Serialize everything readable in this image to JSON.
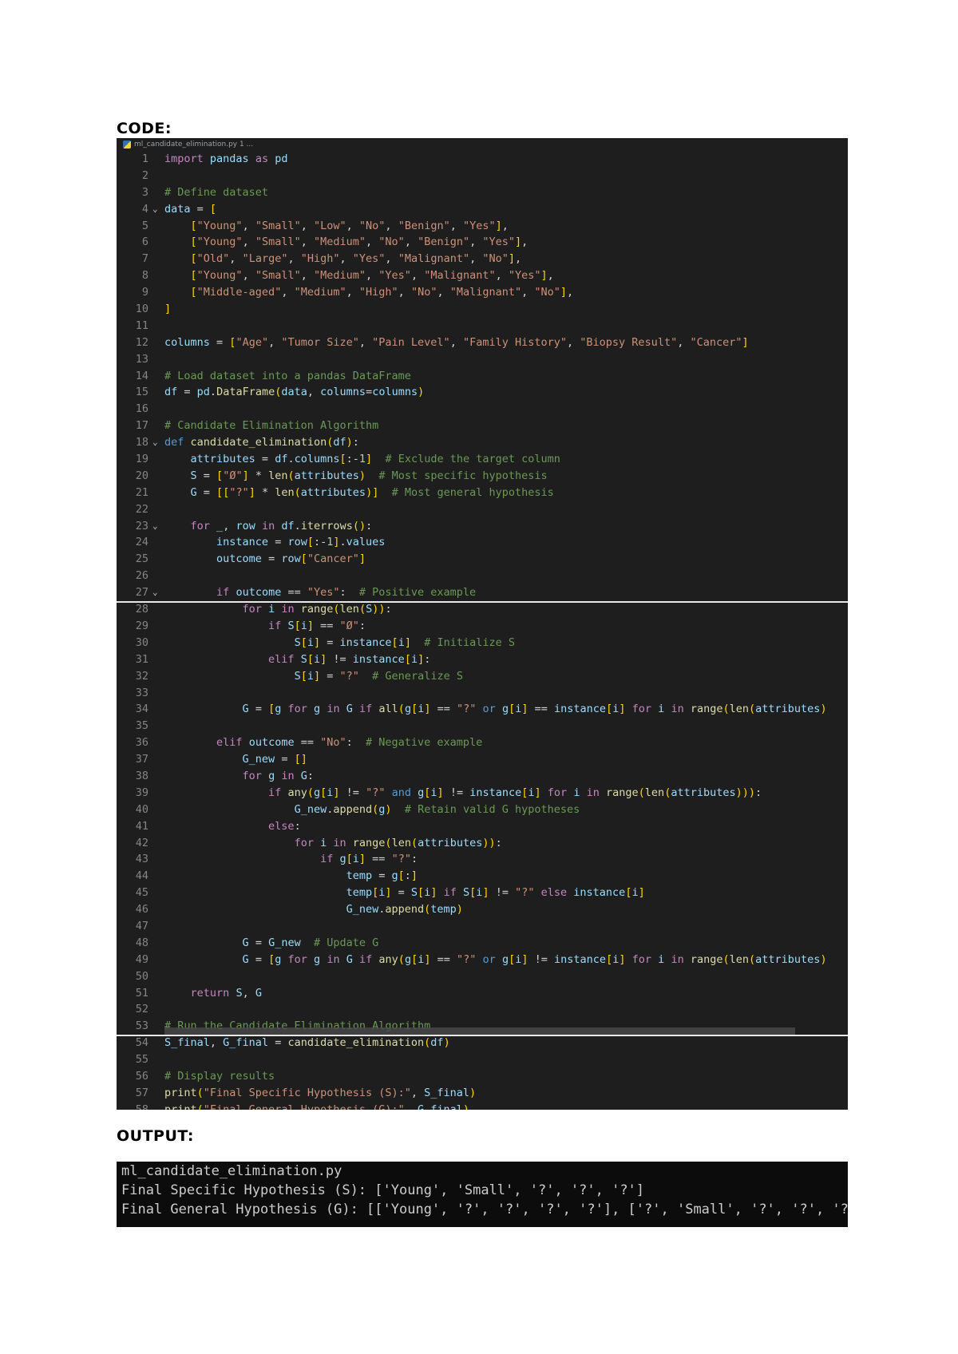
{
  "headings": {
    "code": "CODE:",
    "output": "OUTPUT:"
  },
  "editor": {
    "file_tab": "ml_candidate_elimination.py 1 ...",
    "lines": [
      {
        "n": "1",
        "c": "import pandas as pd"
      },
      {
        "n": "2",
        "c": ""
      },
      {
        "n": "3",
        "c": "# Define dataset"
      },
      {
        "n": "4",
        "c": "data = [",
        "fold": "v"
      },
      {
        "n": "5",
        "c": "    [\"Young\", \"Small\", \"Low\", \"No\", \"Benign\", \"Yes\"],"
      },
      {
        "n": "6",
        "c": "    [\"Young\", \"Small\", \"Medium\", \"No\", \"Benign\", \"Yes\"],"
      },
      {
        "n": "7",
        "c": "    [\"Old\", \"Large\", \"High\", \"Yes\", \"Malignant\", \"No\"],"
      },
      {
        "n": "8",
        "c": "    [\"Young\", \"Small\", \"Medium\", \"Yes\", \"Malignant\", \"Yes\"],"
      },
      {
        "n": "9",
        "c": "    [\"Middle-aged\", \"Medium\", \"High\", \"No\", \"Malignant\", \"No\"],"
      },
      {
        "n": "10",
        "c": "]"
      },
      {
        "n": "11",
        "c": ""
      },
      {
        "n": "12",
        "c": "columns = [\"Age\", \"Tumor Size\", \"Pain Level\", \"Family History\", \"Biopsy Result\", \"Cancer\"]"
      },
      {
        "n": "13",
        "c": ""
      },
      {
        "n": "14",
        "c": "# Load dataset into a pandas DataFrame"
      },
      {
        "n": "15",
        "c": "df = pd.DataFrame(data, columns=columns)"
      },
      {
        "n": "16",
        "c": ""
      },
      {
        "n": "17",
        "c": "# Candidate Elimination Algorithm"
      },
      {
        "n": "18",
        "c": "def candidate_elimination(df):",
        "fold": "v"
      },
      {
        "n": "19",
        "c": "    attributes = df.columns[:-1]  # Exclude the target column"
      },
      {
        "n": "20",
        "c": "    S = [\"Ø\"] * len(attributes)  # Most specific hypothesis"
      },
      {
        "n": "21",
        "c": "    G = [[\"?\"] * len(attributes)]  # Most general hypothesis"
      },
      {
        "n": "22",
        "c": ""
      },
      {
        "n": "23",
        "c": "    for _, row in df.iterrows():",
        "fold": "v"
      },
      {
        "n": "24",
        "c": "        instance = row[:-1].values"
      },
      {
        "n": "25",
        "c": "        outcome = row[\"Cancer\"]"
      },
      {
        "n": "26",
        "c": ""
      },
      {
        "n": "27",
        "c": "        if outcome == \"Yes\":  # Positive example",
        "fold": "v"
      },
      {
        "n": "28",
        "c": "            for i in range(len(S)):"
      },
      {
        "n": "29",
        "c": "                if S[i] == \"Ø\":"
      },
      {
        "n": "30",
        "c": "                    S[i] = instance[i]  # Initialize S"
      },
      {
        "n": "31",
        "c": "                elif S[i] != instance[i]:"
      },
      {
        "n": "32",
        "c": "                    S[i] = \"?\"  # Generalize S"
      },
      {
        "n": "33",
        "c": ""
      },
      {
        "n": "34",
        "c": "            G = [g for g in G if all(g[i] == \"?\" or g[i] == instance[i] for i in range(len(attributes)"
      },
      {
        "n": "35",
        "c": ""
      },
      {
        "n": "36",
        "c": "        elif outcome == \"No\":  # Negative example"
      },
      {
        "n": "37",
        "c": "            G_new = []"
      },
      {
        "n": "38",
        "c": "            for g in G:"
      },
      {
        "n": "39",
        "c": "                if any(g[i] != \"?\" and g[i] != instance[i] for i in range(len(attributes))):"
      },
      {
        "n": "40",
        "c": "                    G_new.append(g)  # Retain valid G hypotheses"
      },
      {
        "n": "41",
        "c": "                else:"
      },
      {
        "n": "42",
        "c": "                    for i in range(len(attributes)):"
      },
      {
        "n": "43",
        "c": "                        if g[i] == \"?\":"
      },
      {
        "n": "44",
        "c": "                            temp = g[:]"
      },
      {
        "n": "45",
        "c": "                            temp[i] = S[i] if S[i] != \"?\" else instance[i]"
      },
      {
        "n": "46",
        "c": "                            G_new.append(temp)"
      },
      {
        "n": "47",
        "c": ""
      },
      {
        "n": "48",
        "c": "            G = G_new  # Update G"
      },
      {
        "n": "49",
        "c": "            G = [g for g in G if any(g[i] == \"?\" or g[i] != instance[i] for i in range(len(attributes)"
      },
      {
        "n": "50",
        "c": ""
      },
      {
        "n": "51",
        "c": "    return S, G"
      },
      {
        "n": "52",
        "c": ""
      },
      {
        "n": "53",
        "c": "# Run the Candidate Elimination Algorithm"
      },
      {
        "n": "54",
        "c": "S_final, G_final = candidate_elimination(df)"
      },
      {
        "n": "55",
        "c": ""
      },
      {
        "n": "56",
        "c": "# Display results"
      },
      {
        "n": "57",
        "c": "print(\"Final Specific Hypothesis (S):\", S_final)"
      },
      {
        "n": "58",
        "c": "print(\"Final General Hypothesis (G):\", G_final)"
      }
    ]
  },
  "terminal": {
    "lines": [
      "ml_candidate_elimination.py",
      "Final Specific Hypothesis (S): ['Young', 'Small', '?', '?', '?']",
      "Final General Hypothesis (G): [['Young', '?', '?', '?', '?'], ['?', 'Small', '?', '?', '?']]"
    ]
  }
}
